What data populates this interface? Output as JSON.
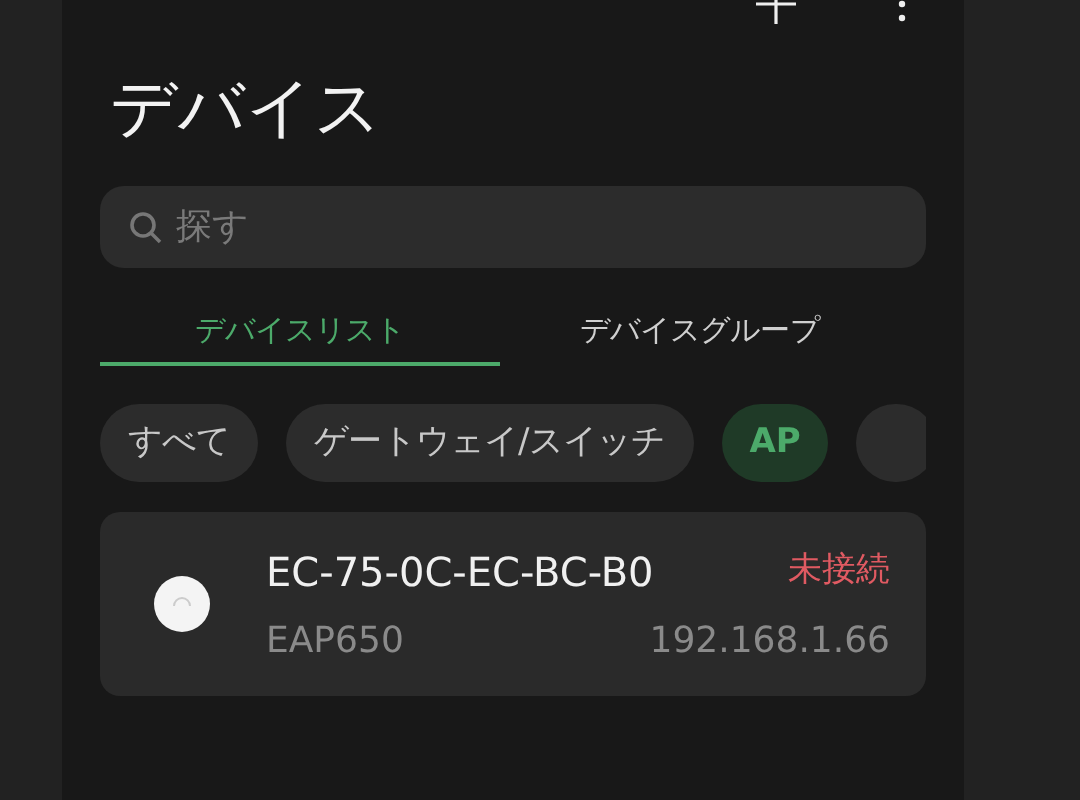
{
  "title": "デバイス",
  "search": {
    "placeholder": "探す"
  },
  "tabs": [
    {
      "label": "デバイスリスト",
      "selected": true
    },
    {
      "label": "デバイスグループ",
      "selected": false
    }
  ],
  "filters": [
    {
      "label": "すべて",
      "selected": false
    },
    {
      "label": "ゲートウェイ/スイッチ",
      "selected": false
    },
    {
      "label": "AP",
      "selected": true
    }
  ],
  "devices": [
    {
      "name": "EC-75-0C-EC-BC-B0",
      "status": "未接続",
      "model": "EAP650",
      "ip": "192.168.1.66",
      "connected": false
    }
  ]
}
